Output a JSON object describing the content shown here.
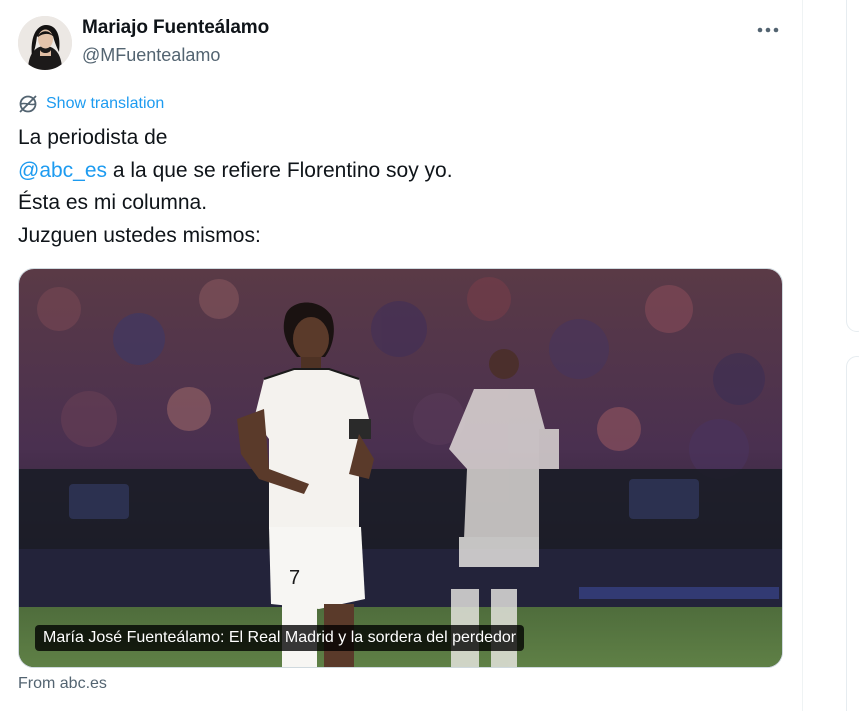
{
  "author": {
    "display_name": "Mariajo Fuenteálamo",
    "handle": "@MFuentealamo",
    "avatar_icon": "profile-photo"
  },
  "actions": {
    "more_icon": "more-horizontal-icon",
    "translate_label": "Show translation",
    "translate_icon": "globe-translate-icon"
  },
  "tweet": {
    "line1": "La periodista de",
    "mention": "@abc_es",
    "line2_rest": " a la que se refiere Florentino soy yo.",
    "line3": "Ésta es mi columna.",
    "line4": "Juzguen ustedes mismos:"
  },
  "card": {
    "caption": "María José Fuenteálamo: El Real Madrid y la sordera del perdedor",
    "source": "From abc.es"
  },
  "colors": {
    "link": "#1d9bf0",
    "secondary_text": "#536471"
  }
}
